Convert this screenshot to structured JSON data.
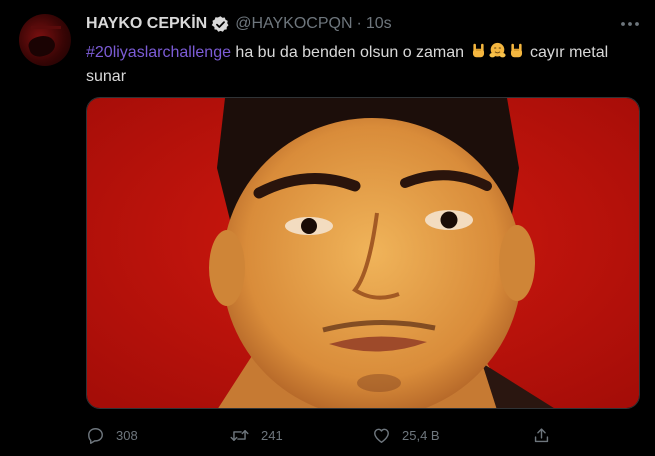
{
  "tweet": {
    "author_name": "HAYKO CEPKİN",
    "handle": "@HAYKOCPQN",
    "separator": "·",
    "time": "10s",
    "hashtag": "#20liyaslarchallenge",
    "text_main": " ha bu da benden olsun o zaman ",
    "text_tail": " cayır metal sunar",
    "emojis": [
      "sign-of-the-horns-icon",
      "hugging-face-icon",
      "sign-of-the-horns-icon"
    ]
  },
  "actions": {
    "reply_count": "308",
    "retweet_count": "241",
    "like_count": "25,4 B"
  },
  "colors": {
    "background": "#000000",
    "text": "#d9d9d9",
    "muted": "#6e767d",
    "hashtag": "#7c5cd6",
    "verified": "#d9d9d9",
    "photo_background": "#c4140e"
  }
}
